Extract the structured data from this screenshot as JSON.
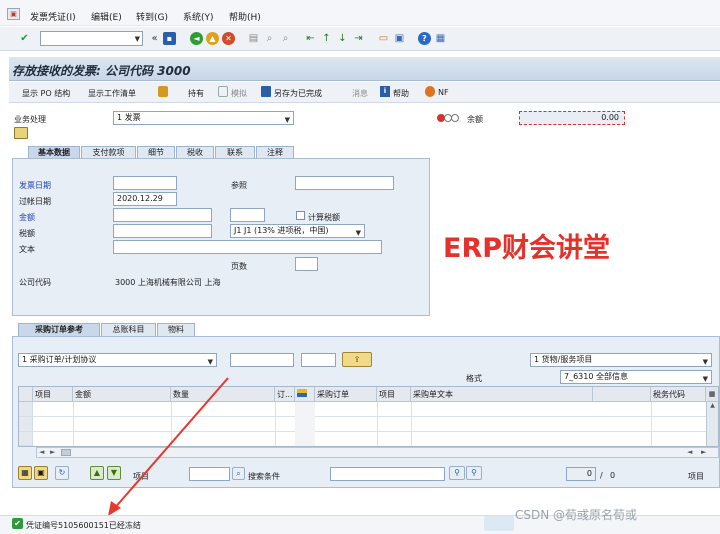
{
  "menu": [
    "发票凭证(I)",
    "编辑(E)",
    "转到(G)",
    "系统(Y)",
    "帮助(H)"
  ],
  "page_title": "存放接收的发票: 公司代码 3000",
  "app_toolbar": {
    "show_po_structure": "显示 PO 结构",
    "show_worklist": "显示工作清单",
    "hold": "持有",
    "simulate": "模拟",
    "save_as_completed": "另存为已完成",
    "messages": "消息",
    "help": "帮助",
    "nf": "NF"
  },
  "header": {
    "transaction_label": "业务处理",
    "transaction_value": "1 发票",
    "balance_label": "余额",
    "balance_value": "0.00",
    "status_color": "#d9302c"
  },
  "tabs_upper": [
    "基本数据",
    "支付款项",
    "细节",
    "税收",
    "联系",
    "注释"
  ],
  "basic_data": {
    "invoice_date_label": "发票日期",
    "invoice_date_value": "",
    "reference_label": "参照",
    "reference_value": "",
    "posting_date_label": "过帐日期",
    "posting_date_value": "2020.12.29",
    "amount_label": "金额",
    "amount_value": "",
    "calc_tax_label": "计算税额",
    "tax_label": "税额",
    "tax_code_value": "J1 J1 (13% 进项税，中国)",
    "text_label": "文本",
    "text_value": "",
    "page_label": "页数",
    "company_code_label": "公司代码",
    "company_code_value": "3000 上海机械有限公司 上海"
  },
  "watermark": "ERP财会讲堂",
  "tabs_lower": [
    "采购订单参考",
    "总账科目",
    "物料"
  ],
  "po_ref": {
    "ref_type": "1 采购订单/计划协议",
    "item_type": "1 货物/服务项目",
    "layout_label": "格式",
    "layout_value": "7_6310 全部信息",
    "columns": [
      "项目",
      "金额",
      "数量",
      "订...",
      "",
      "采购订单",
      "项目",
      "采购单文本",
      "",
      "税务代码"
    ],
    "item_label": "项目",
    "search_label": "搜索条件",
    "count_current": "0",
    "count_sep": "/",
    "count_total": "0",
    "items_suffix": "项目"
  },
  "status_message": "凭证编号5105600151已经冻结",
  "csdn_watermark": "CSDN @荀彧原名荀或"
}
